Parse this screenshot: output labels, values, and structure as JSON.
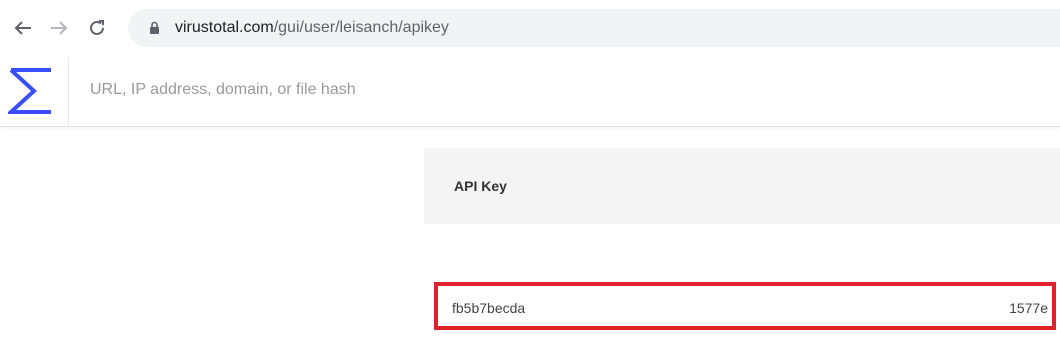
{
  "browser": {
    "url_domain": "virustotal.com",
    "url_path": "/gui/user/leisanch/apikey"
  },
  "header": {
    "logo": "virustotal-logo",
    "search_placeholder": "URL, IP address, domain, or file hash",
    "search_value": ""
  },
  "panel": {
    "title": "API Key",
    "api_key_start": "fb5b7becda",
    "api_key_end": "1577e",
    "highlight_color": "#e0202a"
  },
  "colors": {
    "brand": "#394eff",
    "highlight": "#e0202a"
  }
}
